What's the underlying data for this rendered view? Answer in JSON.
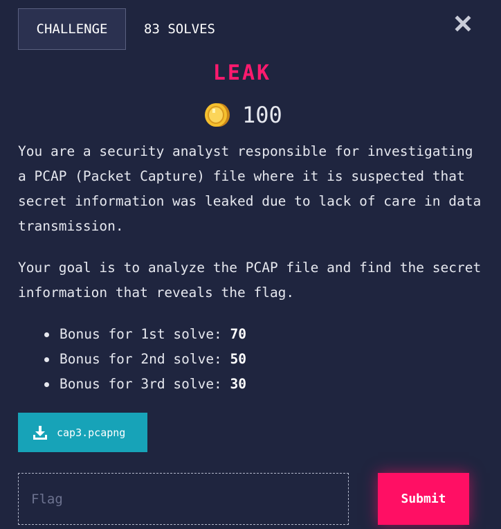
{
  "tabs": {
    "challenge_label": "CHALLENGE",
    "solves_label": "83 SOLVES"
  },
  "close_icon": "close-icon",
  "challenge": {
    "title": "LEAK",
    "points": "100",
    "points_icon": "coin-icon",
    "description": [
      "You are a security analyst responsible for investigating a PCAP (Packet Capture) file where it is suspected that secret information was leaked due to lack of care in data transmission.",
      "Your goal is to analyze the PCAP file and find the secret information that reveals the flag."
    ],
    "bonuses": [
      {
        "label": "Bonus for 1st solve: ",
        "value": "70"
      },
      {
        "label": "Bonus for 2nd solve: ",
        "value": "50"
      },
      {
        "label": "Bonus for 3rd solve: ",
        "value": "30"
      }
    ]
  },
  "file": {
    "name": "cap3.pcapng",
    "icon": "download-icon"
  },
  "flag_input": {
    "placeholder": "Flag",
    "value": ""
  },
  "submit_label": "Submit",
  "colors": {
    "background": "#1f253f",
    "title": "#ff1a6e",
    "download_button": "#17a3b8",
    "submit_button": "#ff0f64"
  }
}
